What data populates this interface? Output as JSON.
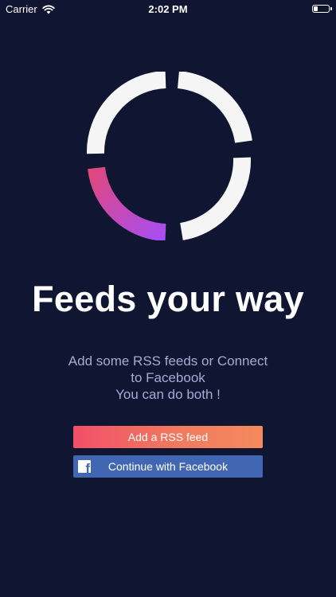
{
  "status_bar": {
    "carrier": "Carrier",
    "time": "2:02 PM",
    "icons": [
      "wifi-icon",
      "battery-icon"
    ]
  },
  "logo": {
    "icon": "feeds-ring-logo-icon",
    "colors": {
      "arcs": "#f5f5f5",
      "accent_start": "#e0477d",
      "accent_end": "#a84df0"
    }
  },
  "onboarding": {
    "headline": "Feeds your way",
    "subtext_lines": [
      "Add some RSS feeds or Connect",
      "to Facebook",
      "You can do both !"
    ]
  },
  "buttons": {
    "add_rss_label": "Add a RSS feed",
    "facebook_label": "Continue with Facebook",
    "facebook_icon": "facebook-icon"
  },
  "colors": {
    "background": "#101631",
    "subtext": "#a8a9d4",
    "rss_gradient_start": "#f14f68",
    "rss_gradient_end": "#f38b5c",
    "facebook_blue": "#4267b2"
  }
}
